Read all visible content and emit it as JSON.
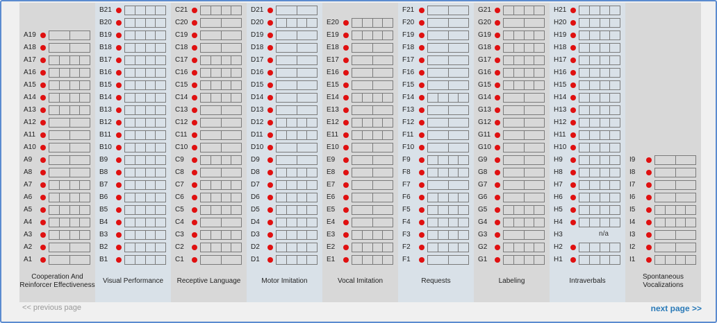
{
  "columns": [
    {
      "letter": "A",
      "name": "Cooperation And Reinforcer Effectiveness",
      "count": 19,
      "shade": "gray",
      "split": {
        "1": 2,
        "2": 2,
        "3": 4,
        "4": 4,
        "5": 4,
        "6": 4,
        "7": 4,
        "8": 2,
        "9": 2,
        "10": 2,
        "11": 2,
        "12": 2,
        "13": 4,
        "14": 4,
        "15": 4,
        "16": 4,
        "17": 4,
        "18": 2,
        "19": 2
      }
    },
    {
      "letter": "B",
      "name": "Visual Performance",
      "count": 21,
      "shade": "blue",
      "split": {}
    },
    {
      "letter": "C",
      "name": "Receptive Language",
      "count": 21,
      "shade": "gray",
      "split": {
        "21": 4,
        "20": 2,
        "19": 2,
        "18": 2,
        "17": 4,
        "16": 4,
        "15": 4,
        "14": 4,
        "13": 2,
        "12": 2,
        "11": 2,
        "10": 2,
        "9": 4,
        "8": 2,
        "7": 4,
        "6": 4,
        "5": 4,
        "4": 2,
        "3": 4,
        "2": 4,
        "1": 2
      }
    },
    {
      "letter": "D",
      "name": "Motor Imitation",
      "count": 21,
      "shade": "blue",
      "split": {
        "21": 2,
        "20": 4,
        "19": 2,
        "18": 2,
        "17": 2,
        "16": 2,
        "15": 2,
        "14": 2,
        "13": 2,
        "12": 4,
        "11": 4,
        "10": 2,
        "9": 2,
        "8": 4,
        "7": 4,
        "6": 4,
        "5": 4,
        "4": 4,
        "3": 4,
        "2": 4,
        "1": 4
      }
    },
    {
      "letter": "E",
      "name": "Vocal Imitation",
      "count": 20,
      "shade": "gray",
      "split": {
        "20": 4,
        "19": 4,
        "18": 2,
        "17": 2,
        "16": 2,
        "15": 2,
        "14": 4,
        "13": 2,
        "12": 4,
        "11": 4,
        "10": 2,
        "9": 2,
        "8": 2,
        "7": 2,
        "6": 2,
        "5": 2,
        "4": 2,
        "3": 4,
        "2": 4,
        "1": 4
      }
    },
    {
      "letter": "F",
      "name": "Requests",
      "count": 21,
      "shade": "blue",
      "split": {
        "21": 2,
        "20": 2,
        "19": 2,
        "18": 2,
        "17": 2,
        "16": 2,
        "15": 2,
        "14": 4,
        "13": 2,
        "12": 2,
        "11": 2,
        "10": 2,
        "9": 4,
        "8": 4,
        "7": 2,
        "6": 4,
        "5": 4,
        "4": 4,
        "3": 4,
        "2": 4,
        "1": 2
      }
    },
    {
      "letter": "G",
      "name": "Labeling",
      "count": 21,
      "shade": "gray",
      "split": {
        "21": 4,
        "20": 2,
        "19": 4,
        "18": 4,
        "17": 4,
        "16": 4,
        "15": 4,
        "14": 2,
        "13": 2,
        "12": 2,
        "11": 2,
        "10": 2,
        "9": 2,
        "8": 2,
        "7": 2,
        "6": 2,
        "5": 4,
        "4": 4,
        "3": 2,
        "2": 4,
        "1": 4
      }
    },
    {
      "letter": "H",
      "name": "Intraverbals",
      "count": 21,
      "shade": "blue",
      "split": {}
    },
    {
      "letter": "I",
      "name": "Spontaneous Vocalizations",
      "count": 9,
      "shade": "gray",
      "split": {
        "9": 2,
        "8": 2,
        "7": 2,
        "6": 2,
        "5": 4,
        "4": 4,
        "3": 2,
        "2": 2,
        "1": 4
      }
    }
  ],
  "na_label": "n/a",
  "na_item": "H3",
  "nav": {
    "prev": "<< previous page",
    "next": "next page >>"
  }
}
